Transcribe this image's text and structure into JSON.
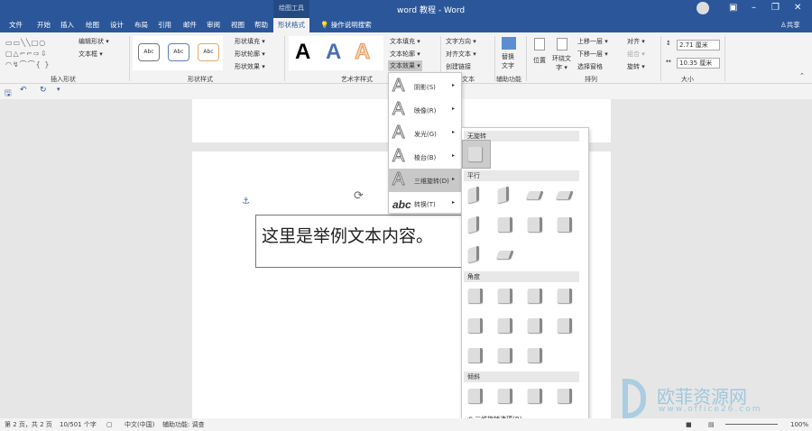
{
  "window": {
    "context_tab": "绘图工具",
    "title": "word 教程  -  Word",
    "share": "共享"
  },
  "tabs": [
    "文件",
    "开始",
    "插入",
    "绘图",
    "设计",
    "布局",
    "引用",
    "邮件",
    "审阅",
    "视图",
    "帮助",
    "形状格式"
  ],
  "search": "操作说明搜索",
  "ribbon": {
    "insert_shapes": {
      "label": "插入形状",
      "edit_shape": "编辑形状 ▾",
      "textbox": "文本框 ▾"
    },
    "shape_styles": {
      "label": "形状样式",
      "preset": "Abc",
      "fill": "形状填充 ▾",
      "outline": "形状轮廓 ▾",
      "effects": "形状效果 ▾"
    },
    "wordart": {
      "label": "艺术字样式",
      "sample": "A",
      "text_fill": "文本填充 ▾",
      "text_outline": "文本轮廓 ▾",
      "text_effects": "文本效果 ▾"
    },
    "text": {
      "label": "文本",
      "direction": "文字方向 ▾",
      "align": "对齐文本 ▾",
      "link": "创建链接"
    },
    "accessibility": {
      "label": "辅助功能",
      "alt_text": "替换\n文字"
    },
    "arrange": {
      "label": "排列",
      "position": "位置",
      "wrap": "环绕文\n字 ▾",
      "forward": "上移一层 ▾",
      "backward": "下移一层 ▾",
      "pane": "选择窗格",
      "align": "对齐 ▾",
      "group": "组合 ▾",
      "rotate": "旋转 ▾"
    },
    "size": {
      "label": "大小",
      "height": "2.71 厘米",
      "width": "10.35 厘米"
    }
  },
  "document": {
    "text": "这里是举例文本内容。"
  },
  "text_effects_menu": [
    {
      "label": "阴影(S)",
      "icon": "A"
    },
    {
      "label": "映像(R)",
      "icon": "A"
    },
    {
      "label": "发光(G)",
      "icon": "A"
    },
    {
      "label": "棱台(B)",
      "icon": "A"
    },
    {
      "label": "三维旋转(D)",
      "icon": "A",
      "selected": true
    },
    {
      "label": "转换(T)",
      "icon": "abc"
    }
  ],
  "rotation_gallery": {
    "sections": [
      {
        "title": "无旋转",
        "count": 1
      },
      {
        "title": "平行",
        "count": 10
      },
      {
        "title": "角度",
        "count": 11
      },
      {
        "title": "倾斜",
        "count": 4
      }
    ],
    "options": "三维旋转选项(R)..."
  },
  "status": {
    "page": "第 2 页，共 2 页",
    "words": "10/501 个字",
    "language": "中文(中国)",
    "accessibility": "辅助功能: 调查",
    "zoom": "100%"
  },
  "watermark": {
    "text": "欧菲资源网",
    "url": "www.office26.com"
  }
}
